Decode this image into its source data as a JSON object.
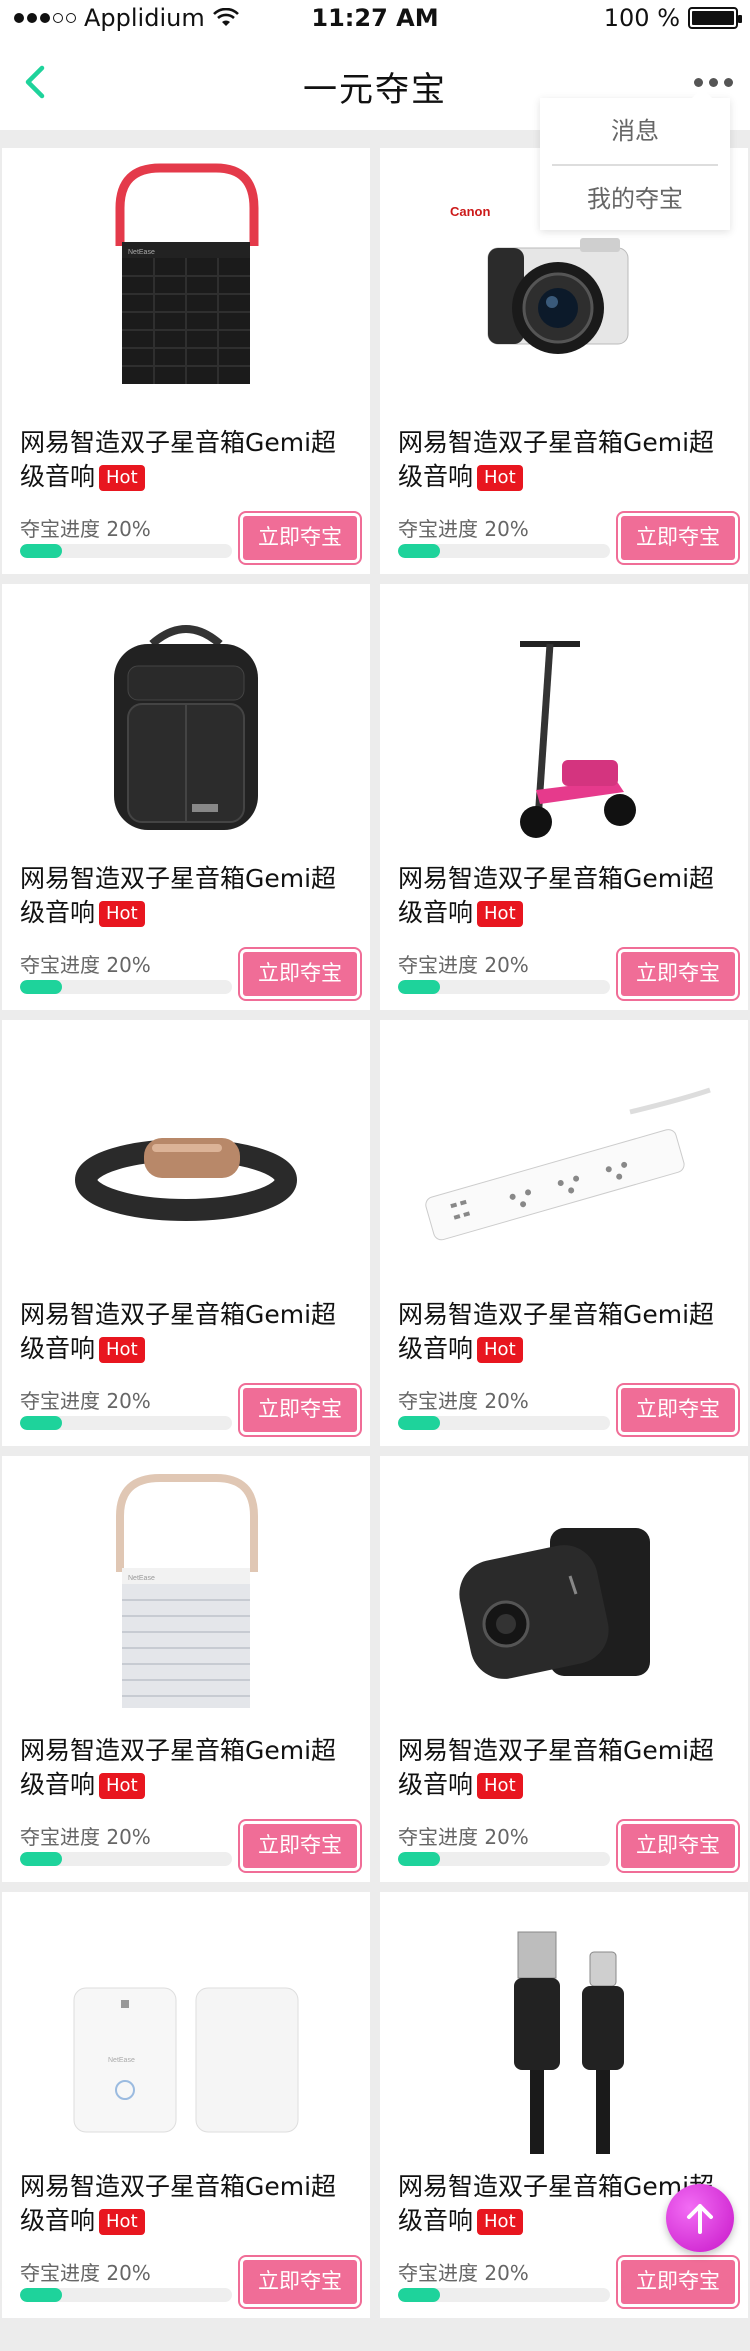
{
  "status_bar": {
    "carrier": "Applidium",
    "time": "11:27 AM",
    "battery": "100 %"
  },
  "nav": {
    "title": "一元夺宝",
    "back_icon": "chevron-left-icon",
    "more_icon": "more-dots-icon",
    "accent": "#1ed39b"
  },
  "dropdown": {
    "items": [
      "消息",
      "我的夺宝"
    ]
  },
  "products": [
    {
      "name": "网易智造双子星音箱Gemi超级音响",
      "badge": "Hot",
      "progress_text": "夺宝进度 20%",
      "progress": 0.2,
      "button": "立即夺宝",
      "image": "speaker-black-icon",
      "brand_text": "NetEase"
    },
    {
      "name": "网易智造双子星音箱Gemi超级音响",
      "badge": "Hot",
      "progress_text": "夺宝进度 20%",
      "progress": 0.2,
      "button": "立即夺宝",
      "image": "camera-icon",
      "brand_text": "Canon"
    },
    {
      "name": "网易智造双子星音箱Gemi超级音响",
      "badge": "Hot",
      "progress_text": "夺宝进度 20%",
      "progress": 0.2,
      "button": "立即夺宝",
      "image": "backpack-icon"
    },
    {
      "name": "网易智造双子星音箱Gemi超级音响",
      "badge": "Hot",
      "progress_text": "夺宝进度 20%",
      "progress": 0.2,
      "button": "立即夺宝",
      "image": "scooter-icon"
    },
    {
      "name": "网易智造双子星音箱Gemi超级音响",
      "badge": "Hot",
      "progress_text": "夺宝进度 20%",
      "progress": 0.2,
      "button": "立即夺宝",
      "image": "fitness-band-icon"
    },
    {
      "name": "网易智造双子星音箱Gemi超级音响",
      "badge": "Hot",
      "progress_text": "夺宝进度 20%",
      "progress": 0.2,
      "button": "立即夺宝",
      "image": "power-strip-icon"
    },
    {
      "name": "网易智造双子星音箱Gemi超级音响",
      "badge": "Hot",
      "progress_text": "夺宝进度 20%",
      "progress": 0.2,
      "button": "立即夺宝",
      "image": "speaker-white-icon",
      "brand_text": "NetEase"
    },
    {
      "name": "网易智造双子星音箱Gemi超级音响",
      "badge": "Hot",
      "progress_text": "夺宝进度 20%",
      "progress": 0.2,
      "button": "立即夺宝",
      "image": "smart-lock-icon"
    },
    {
      "name": "网易智造双子星音箱Gemi超级音响",
      "badge": "Hot",
      "progress_text": "夺宝进度 20%",
      "progress": 0.2,
      "button": "立即夺宝",
      "image": "router-pair-icon",
      "brand_text": "NetEase"
    },
    {
      "name": "网易智造双子星音箱Gemi超级音响",
      "badge": "Hot",
      "progress_text": "夺宝进度 20%",
      "progress": 0.2,
      "button": "立即夺宝",
      "image": "usb-cable-icon"
    }
  ],
  "fab": {
    "icon": "arrow-up-icon",
    "color": "#d52bd6"
  },
  "colors": {
    "hot": "#e8161f",
    "button": "#f06d97",
    "progress": "#1ed39b"
  }
}
